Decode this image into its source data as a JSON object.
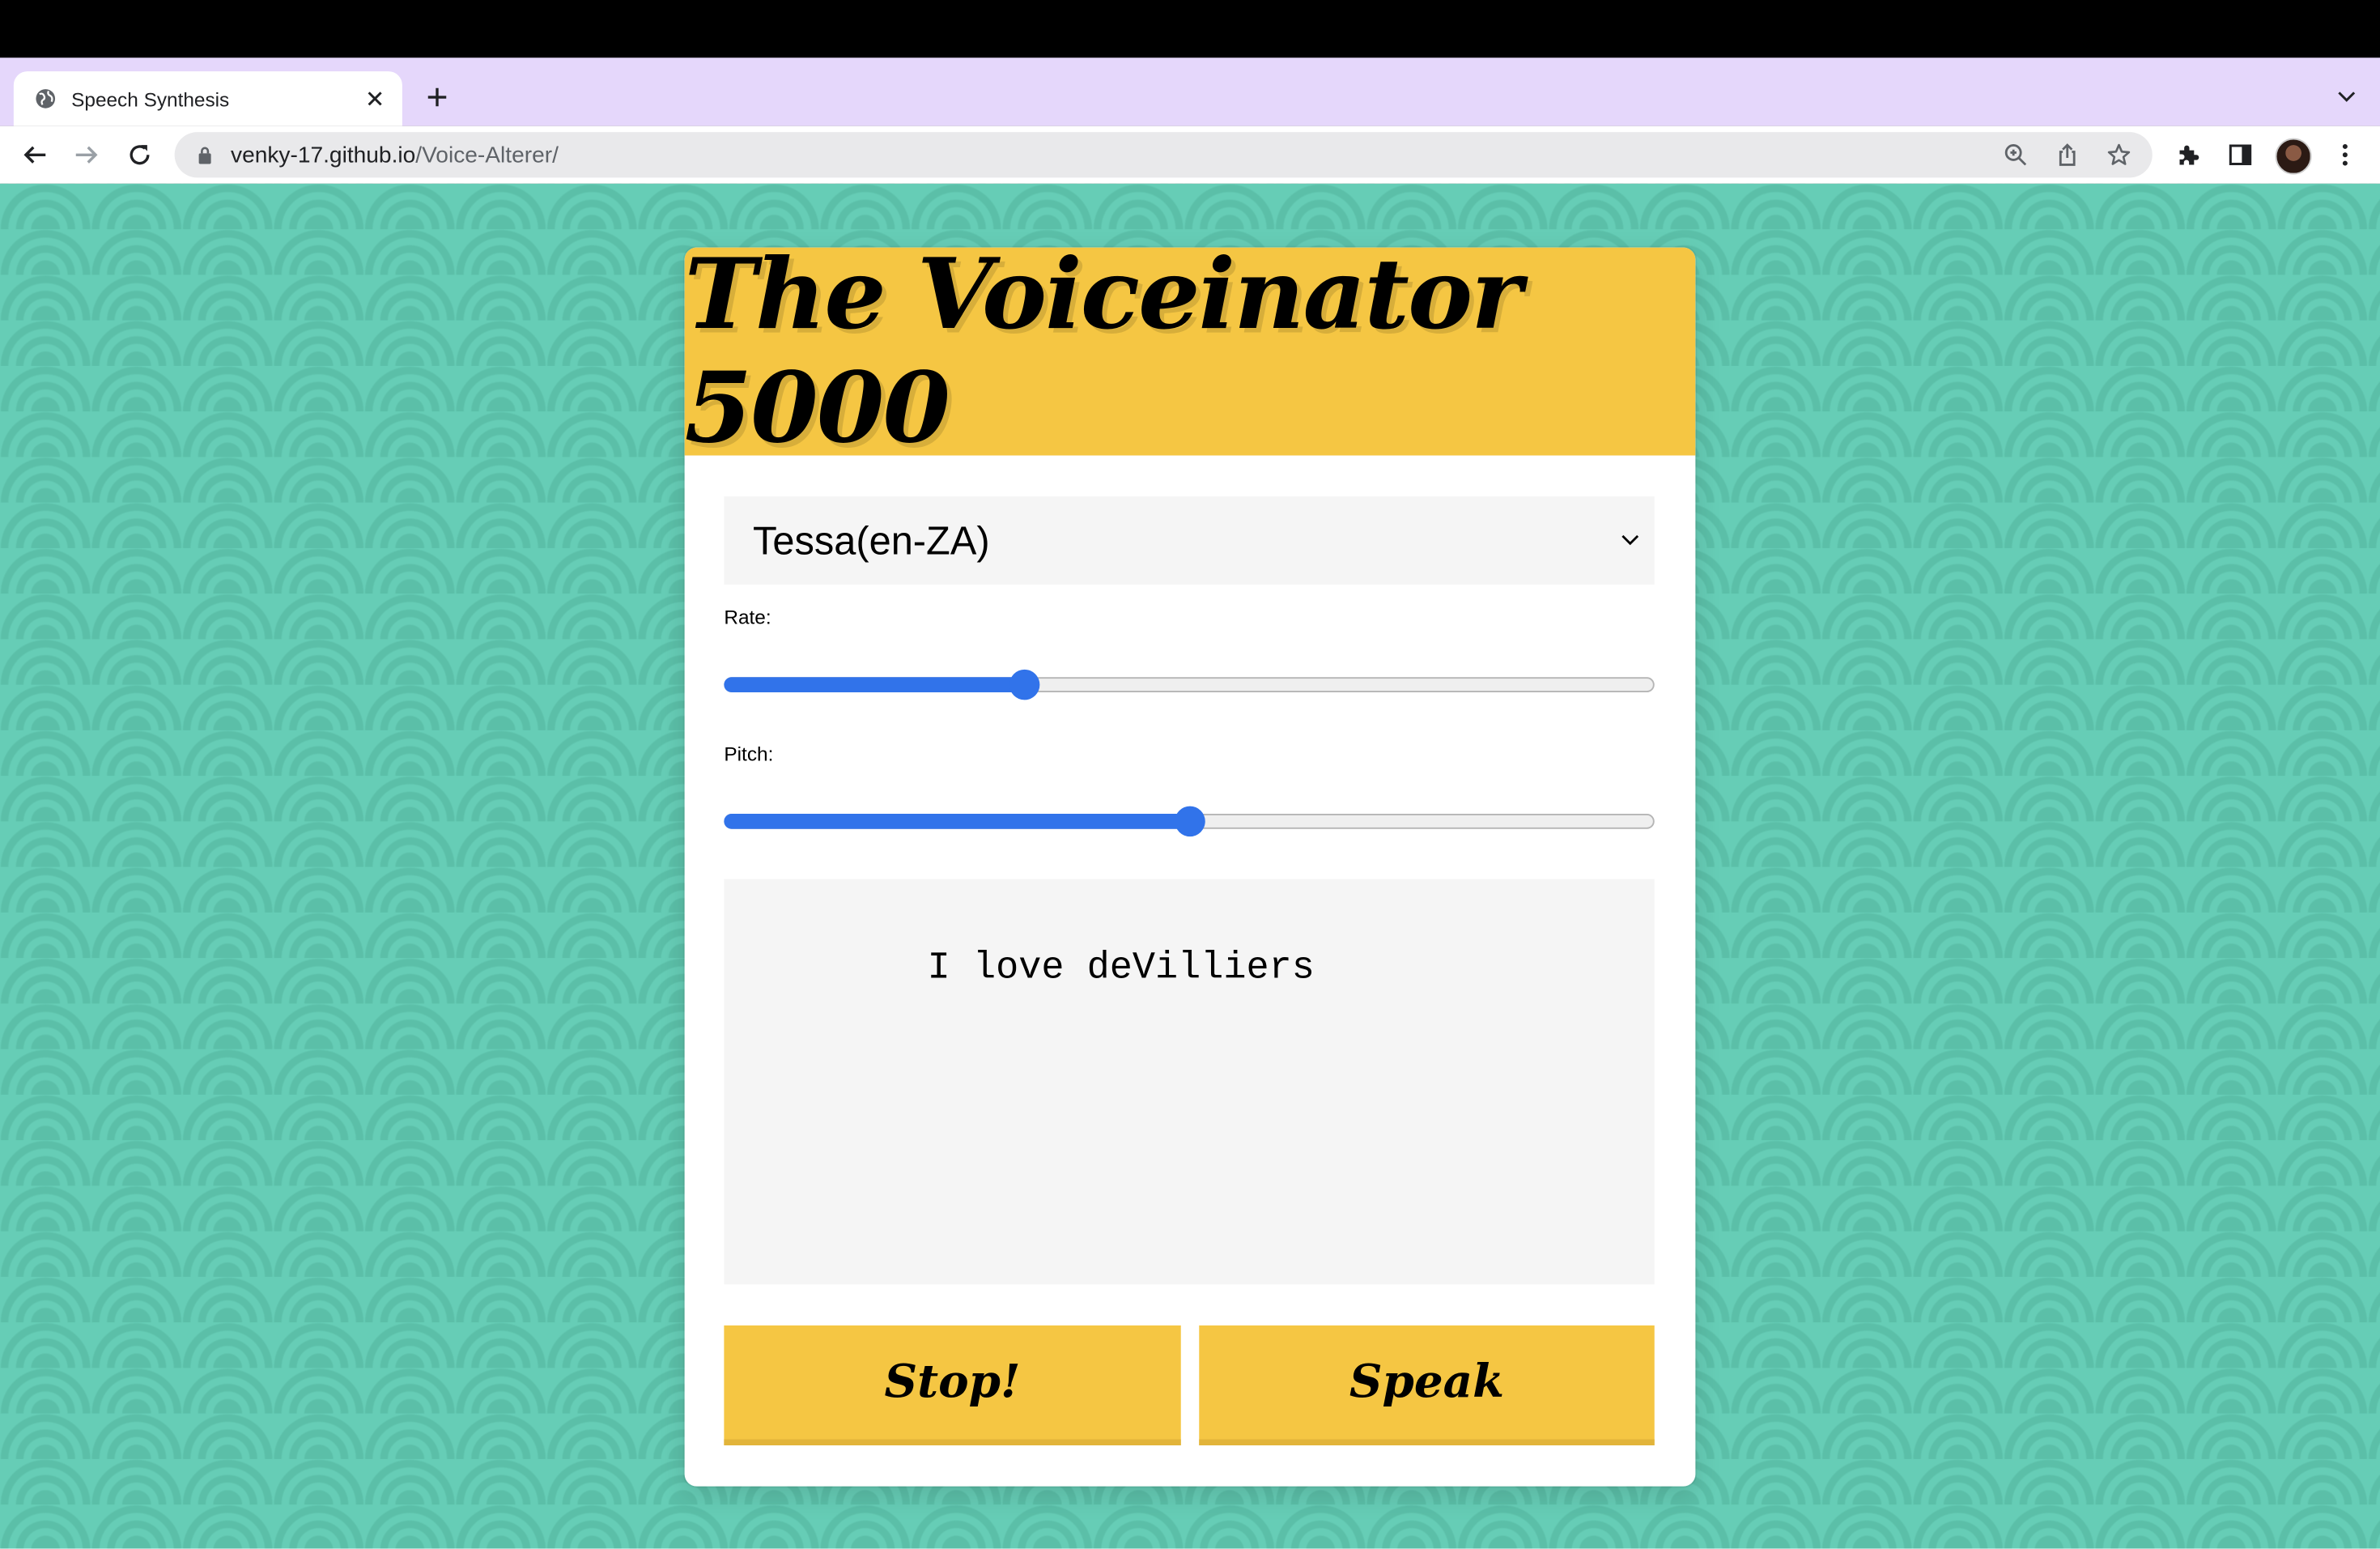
{
  "browser": {
    "tab_title": "Speech Synthesis",
    "url_host": "venky-17.github.io",
    "url_path": "/Voice-Alterer/",
    "icons": [
      "globe-icon",
      "close-icon",
      "plus-icon",
      "chevron-down-icon",
      "back-arrow-icon",
      "forward-arrow-icon",
      "reload-icon",
      "lock-icon",
      "zoom-icon",
      "share-icon",
      "star-icon",
      "puzzle-icon",
      "side-panel-icon",
      "avatar",
      "kebab-menu-icon"
    ]
  },
  "app": {
    "title": "The Voiceinator 5000",
    "voice_select": {
      "selected": "Tessa(en-ZA)"
    },
    "rate": {
      "label": "Rate:",
      "value_fraction": 0.317
    },
    "pitch": {
      "label": "Pitch:",
      "value_fraction": 0.5
    },
    "text": "I love deVilliers",
    "stop_label": "Stop!",
    "speak_label": "Speak"
  },
  "colors": {
    "accent_yellow": "#f5c643",
    "background_teal": "#66cdb6",
    "slider_blue": "#3173ea",
    "tabstrip_lavender": "#e5d7fb"
  }
}
